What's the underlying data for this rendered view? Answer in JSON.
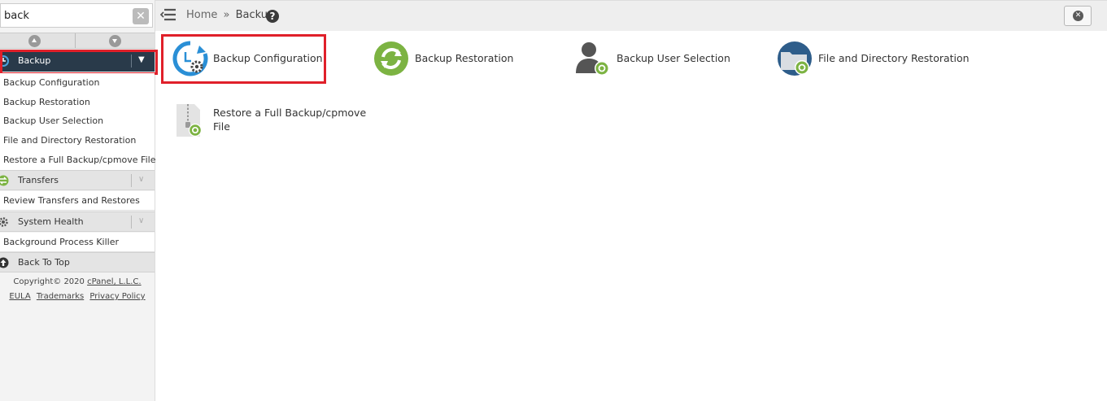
{
  "sidebar": {
    "search": {
      "value": "back",
      "placeholder": ""
    },
    "categories": {
      "backup": {
        "label": "Backup"
      },
      "transfers": {
        "label": "Transfers"
      },
      "system_health": {
        "label": "System Health"
      },
      "back_to_top": {
        "label": "Back To Top"
      }
    },
    "backup_items": [
      "Backup Configuration",
      "Backup Restoration",
      "Backup User Selection",
      "File and Directory Restoration",
      "Restore a Full Backup/cpmove File"
    ],
    "transfers_items": [
      "Review Transfers and Restores"
    ],
    "system_health_items": [
      "Background Process Killer"
    ],
    "footer": {
      "copyright": "Copyright© 2020",
      "company": "cPanel, L.L.C.",
      "eula": "EULA",
      "trademarks": "Trademarks",
      "privacy": "Privacy Policy"
    }
  },
  "breadcrumb": {
    "home": "Home",
    "sep": "»",
    "current": "Backup"
  },
  "tiles": [
    {
      "label": "Backup Configuration",
      "icon": "backup-configuration-icon"
    },
    {
      "label": "Backup Restoration",
      "icon": "backup-restoration-icon"
    },
    {
      "label": "Backup User Selection",
      "icon": "backup-user-selection-icon"
    },
    {
      "label": "File and Directory Restoration",
      "icon": "file-directory-restoration-icon"
    },
    {
      "label_line1": "Restore a Full Backup/cpmove",
      "label_line2": "File",
      "icon": "restore-full-backup-icon"
    }
  ],
  "colors": {
    "accent_dark": "#293a4a",
    "highlight": "#e0202a",
    "green": "#7cb342",
    "blue": "#2a8fd6"
  }
}
